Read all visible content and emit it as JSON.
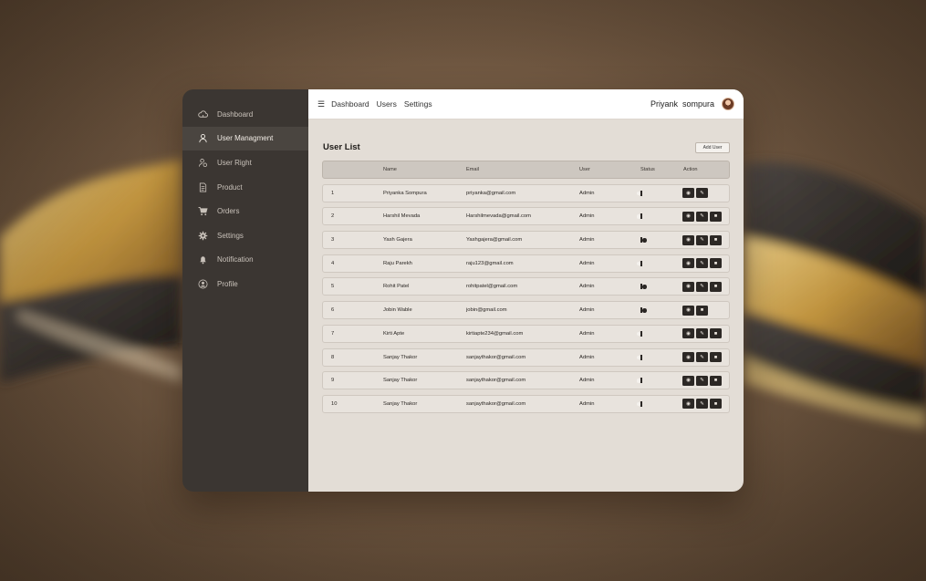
{
  "sidebar": {
    "items": [
      {
        "label": "Dashboard",
        "icon": "cloud-icon",
        "active": false
      },
      {
        "label": "User Managment",
        "icon": "user-icon",
        "active": true
      },
      {
        "label": "User Right",
        "icon": "user-rights-icon",
        "active": false
      },
      {
        "label": "Product",
        "icon": "document-icon",
        "active": false
      },
      {
        "label": "Orders",
        "icon": "cart-icon",
        "active": false
      },
      {
        "label": "Settings",
        "icon": "gear-icon",
        "active": false
      },
      {
        "label": "Notification",
        "icon": "bell-icon",
        "active": false
      },
      {
        "label": "Profile",
        "icon": "profile-icon",
        "active": false
      }
    ]
  },
  "topbar": {
    "nav": [
      "Dashboard",
      "Users",
      "Settings"
    ],
    "user_name": "Priyank  sompura"
  },
  "main": {
    "title": "User List",
    "add_user_label": "Add User"
  },
  "table": {
    "headers": [
      "",
      "Name",
      "Email",
      "User",
      "Status",
      "Action"
    ],
    "rows": [
      {
        "no": "1",
        "name": "Priyanka Sompura",
        "email": "priyanka@gmail.com",
        "role": "Admin",
        "status": "on",
        "actions": [
          "view",
          "edit"
        ]
      },
      {
        "no": "2",
        "name": "Harshil Mevada",
        "email": "Harshilmevada@gmail.com",
        "role": "Admin",
        "status": "on",
        "actions": [
          "view",
          "edit",
          "delete"
        ]
      },
      {
        "no": "3",
        "name": "Yash Gajera",
        "email": "Yashgajera@gmail.com",
        "role": "Admin",
        "status": "off",
        "actions": [
          "view",
          "edit",
          "delete"
        ]
      },
      {
        "no": "4",
        "name": "Raju Parekh",
        "email": "raju123@gmail.com",
        "role": "Admin",
        "status": "on",
        "actions": [
          "view",
          "edit",
          "delete"
        ]
      },
      {
        "no": "5",
        "name": "Rohit Patel",
        "email": "rohitpatel@gmail.com",
        "role": "Admin",
        "status": "off",
        "actions": [
          "view",
          "edit",
          "delete"
        ]
      },
      {
        "no": "6",
        "name": "Jobin Wable",
        "email": "jobin@gmail.com",
        "role": "Admin",
        "status": "off",
        "actions": [
          "view",
          "delete"
        ]
      },
      {
        "no": "7",
        "name": "Kirti Apte",
        "email": "kirtiapte234@gmail.com",
        "role": "Admin",
        "status": "on",
        "actions": [
          "view",
          "edit",
          "delete"
        ]
      },
      {
        "no": "8",
        "name": "Sanjay Thakor",
        "email": "sanjaythakor@gmail.com",
        "role": "Admin",
        "status": "on",
        "actions": [
          "view",
          "edit",
          "delete"
        ]
      },
      {
        "no": "9",
        "name": "Sanjay Thakor",
        "email": "sanjaythakor@gmail.com",
        "role": "Admin",
        "status": "on",
        "actions": [
          "view",
          "edit",
          "delete"
        ]
      },
      {
        "no": "10",
        "name": "Sanjay Thakor",
        "email": "sanjaythakor@gmail.com",
        "role": "Admin",
        "status": "on",
        "actions": [
          "view",
          "edit",
          "delete"
        ]
      }
    ]
  },
  "colors": {
    "sidebar_bg": "#3b3632",
    "content_bg": "#e3ddd6",
    "action_button": "#2c2825"
  }
}
